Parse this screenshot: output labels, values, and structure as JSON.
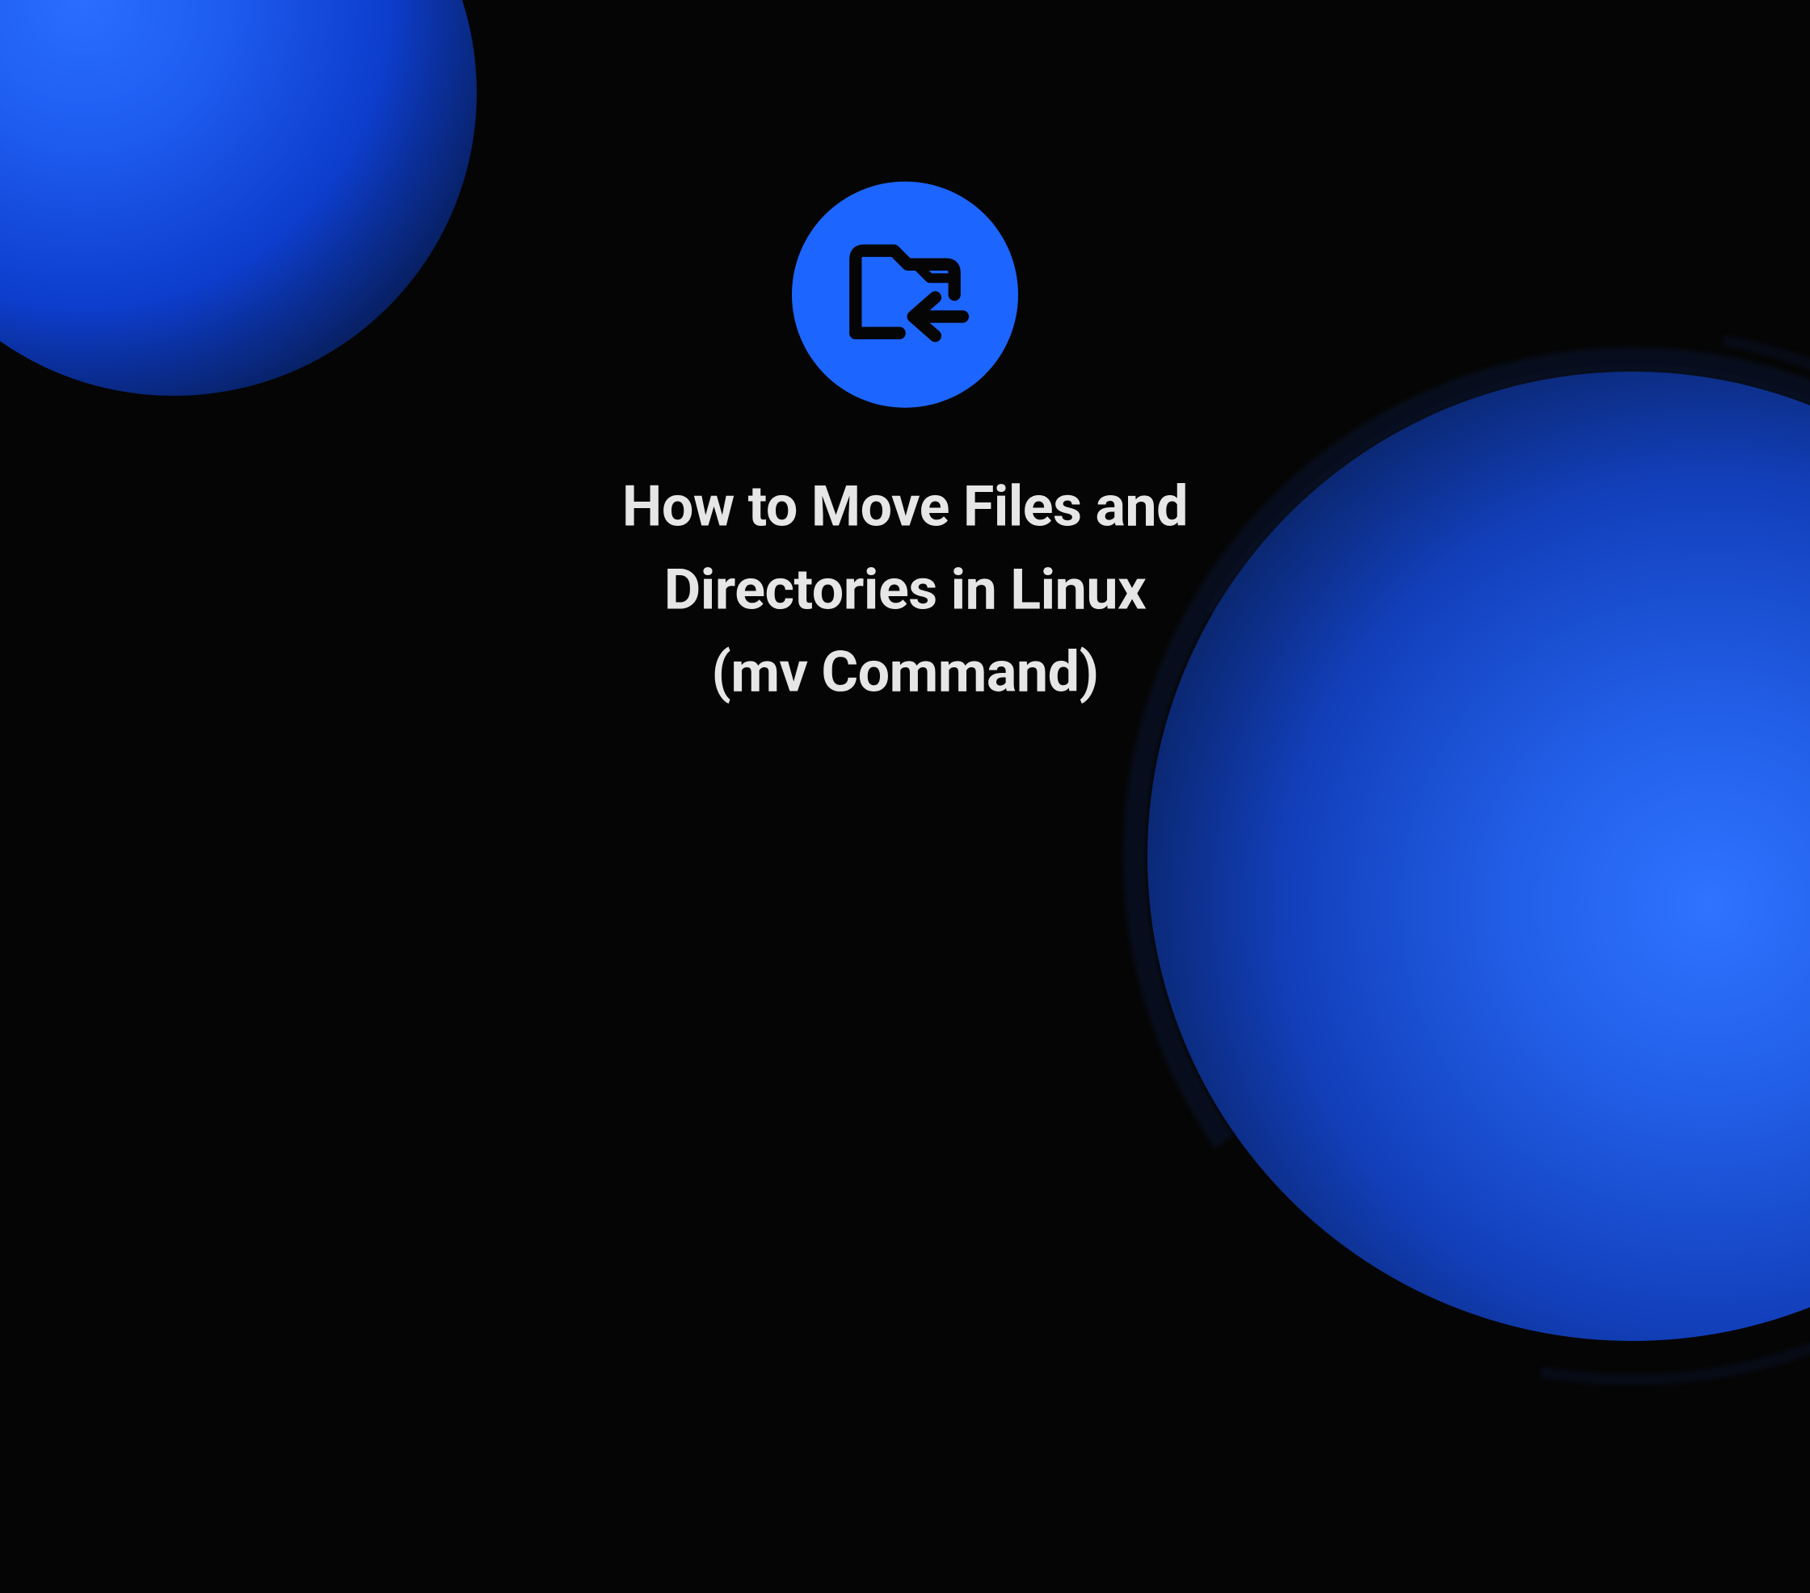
{
  "title": {
    "line1": "How to Move Files and",
    "line2": "Directories in Linux",
    "line3": "(mv Command)"
  },
  "icon": {
    "name": "folder-move"
  },
  "colors": {
    "accent": "#1d65ff",
    "background": "#050505",
    "text": "#e6e6e6"
  }
}
